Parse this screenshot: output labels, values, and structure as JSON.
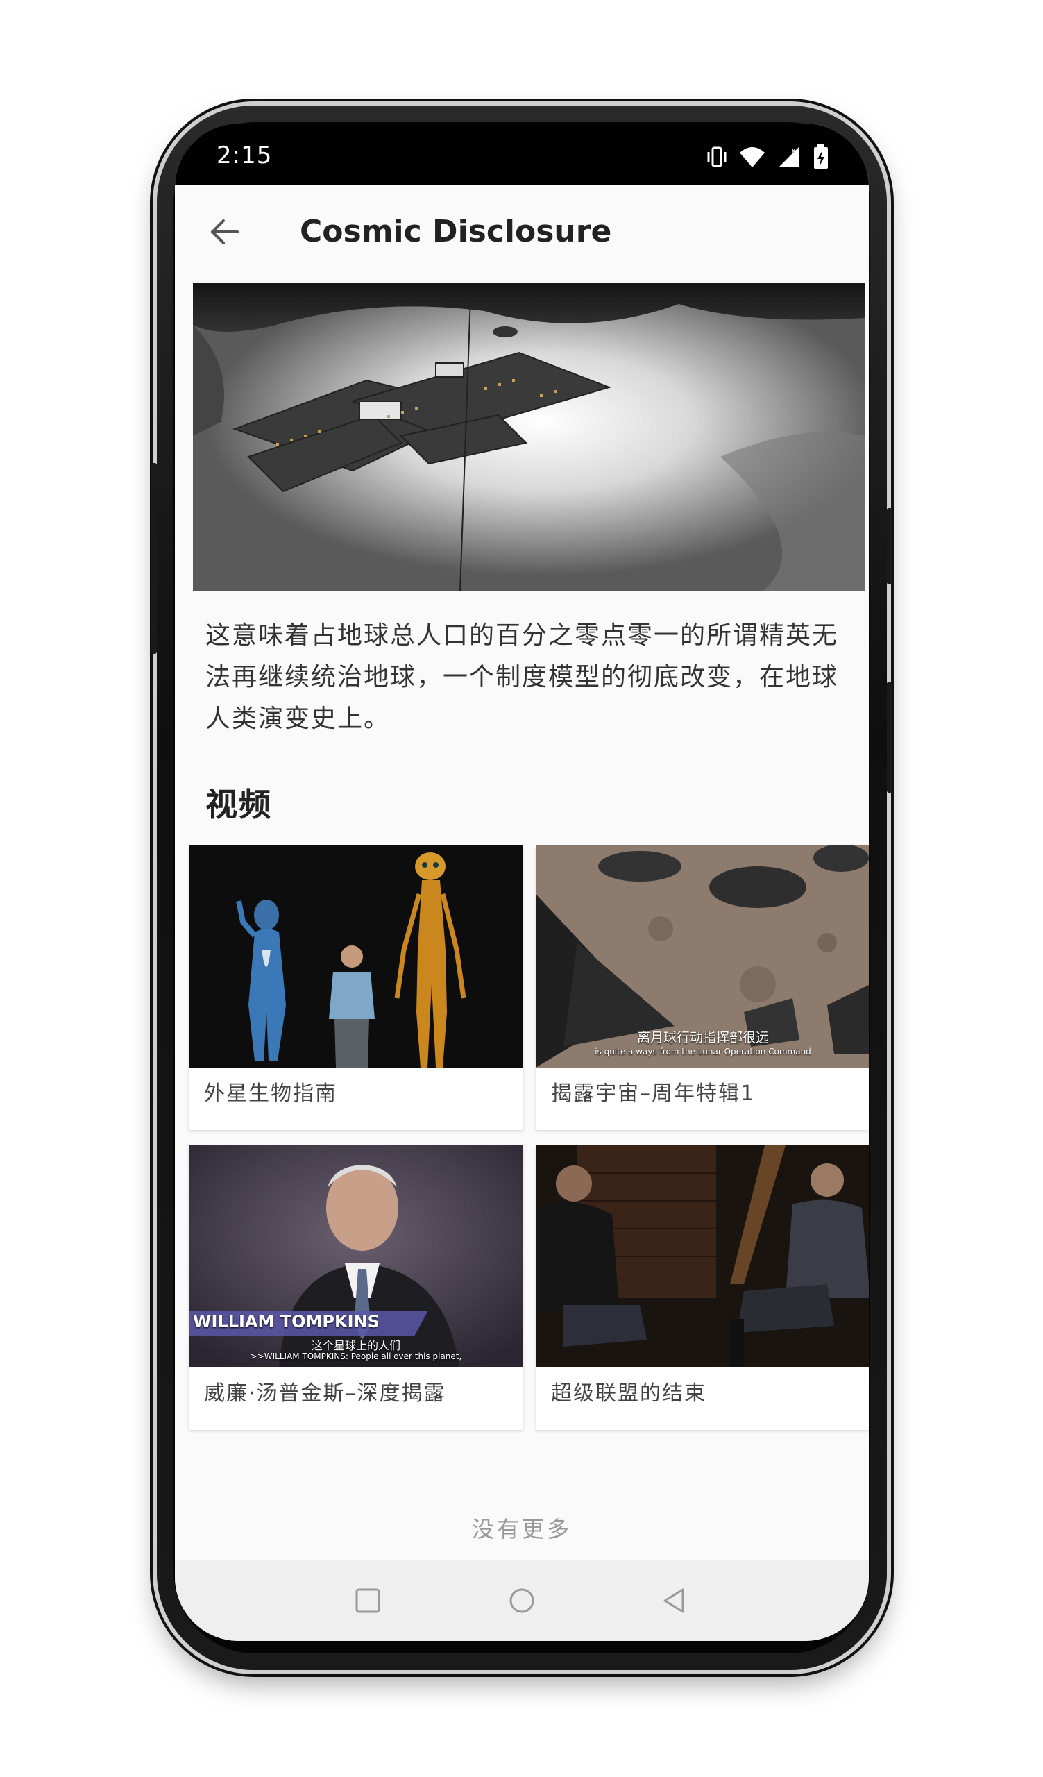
{
  "status_bar": {
    "time": "2:15"
  },
  "app_bar": {
    "title": "Cosmic Disclosure",
    "back_icon": "arrow-back-icon"
  },
  "article": {
    "paragraph": "这意味着占地球总人口的百分之零点零一的所谓精英无法再继续统治地球，一个制度模型的彻底改变，在地球人类演变史上。"
  },
  "videos_section": {
    "heading": "视频",
    "items": [
      {
        "title": "外星生物指南"
      },
      {
        "title": "揭露宇宙–周年特辑1",
        "subtitle_cn": "离月球行动指挥部很远",
        "subtitle_en": "is quite a ways from the Lunar Operation Command"
      },
      {
        "title": "威廉·汤普金斯–深度揭露",
        "banner_name": "WILLIAM TOMPKINS",
        "subtitle_cn": "这个星球上的人们",
        "subtitle_en": ">>WILLIAM TOMPKINS: People all over this planet,"
      },
      {
        "title": "超级联盟的结束"
      }
    ]
  },
  "footer": {
    "no_more": "没有更多"
  },
  "nav_bar": {
    "recents_icon": "square-icon",
    "home_icon": "circle-icon",
    "back_icon": "triangle-back-icon"
  }
}
